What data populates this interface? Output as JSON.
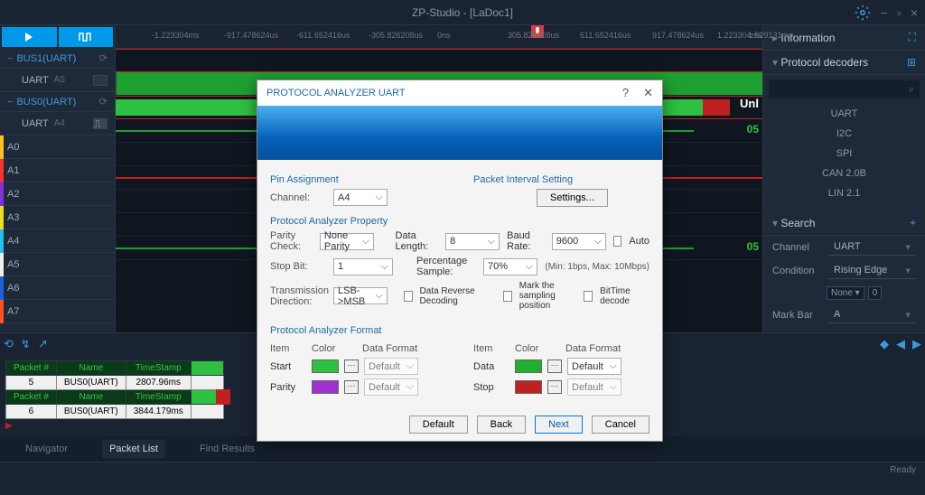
{
  "title": "ZP-Studio - [LaDoc1]",
  "timeline": [
    "-1.223304ms",
    "-917.478624us",
    "-611.652416us",
    "-305.826208us",
    "0ns",
    "305.826208us",
    "611.652416us",
    "917.478624us",
    "1.223304ms",
    "1.529131ms"
  ],
  "buses": [
    "BUS1(UART)",
    "BUS0(UART)"
  ],
  "channels": [
    {
      "name": "UART",
      "sub": "A5"
    },
    {
      "name": "UART",
      "sub": "A4"
    }
  ],
  "signals": [
    "A0",
    "A1",
    "A2",
    "A3",
    "A4",
    "A5",
    "A6",
    "A7"
  ],
  "unknown_label": "Unknown",
  "unl_label": "Unl",
  "tick_text": "05",
  "right": {
    "info": "Information",
    "decoders": "Protocol decoders",
    "decoder_list": [
      "UART",
      "I2C",
      "SPI",
      "CAN 2.0B",
      "LIN 2.1"
    ],
    "search": "Search",
    "channel_label": "Channel",
    "channel_value": "UART",
    "condition_label": "Condition",
    "condition_value": "Rising Edge",
    "none": "None",
    "zero": "0",
    "markbar_label": "Mark Bar",
    "markbar_value": "A"
  },
  "packet": {
    "headers": [
      "Packet #",
      "Name",
      "TimeStamp"
    ],
    "row1": [
      "5",
      "BUS0(UART)",
      "2807.96ms"
    ],
    "row2": [
      "6",
      "BUS0(UART)",
      "3844.179ms"
    ]
  },
  "tabs": [
    "Navigator",
    "Packet List",
    "Find Results"
  ],
  "status": "Ready",
  "dialog": {
    "title": "PROTOCOL ANALYZER UART",
    "pin_assignment": "Pin Assignment",
    "channel_label": "Channel:",
    "channel_value": "A4",
    "packet_interval": "Packet Interval Setting",
    "settings_btn": "Settings...",
    "prop": "Protocol Analyzer Property",
    "parity_label": "Parity Check:",
    "parity_value": "None Parity",
    "datalen_label": "Data Length:",
    "datalen_value": "8",
    "baud_label": "Baud Rate:",
    "baud_value": "9600",
    "auto": "Auto",
    "baud_hint": "(Min: 1bps, Max: 10Mbps)",
    "stopbit_label": "Stop Bit:",
    "stopbit_value": "1",
    "percent_label": "Percentage Sample:",
    "percent_value": "70%",
    "trans_label": "Transmission Direction:",
    "trans_value": "LSB->MSB",
    "reverse": "Data Reverse Decoding",
    "mark_sampling": "Mark the sampling position",
    "bittime": "BitTime decode",
    "fmt": "Protocol Analyzer Format",
    "fmt_item": "Item",
    "fmt_color": "Color",
    "fmt_data": "Data Format",
    "fmt_start": "Start",
    "fmt_parity": "Parity",
    "fmt_data_item": "Data",
    "fmt_stop": "Stop",
    "fmt_default": "Default",
    "btn_default": "Default",
    "btn_back": "Back",
    "btn_next": "Next",
    "btn_cancel": "Cancel"
  }
}
